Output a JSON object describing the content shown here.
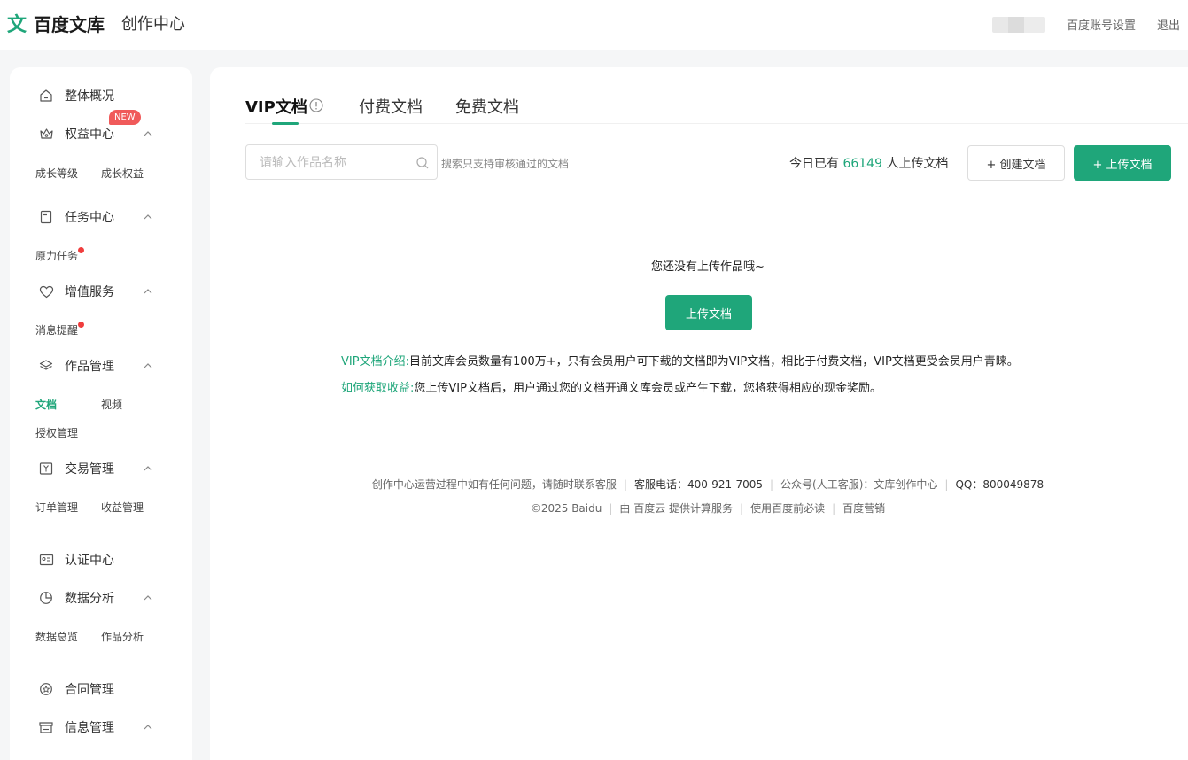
{
  "header": {
    "logo_mark": "文",
    "logo_text": "百度文库",
    "logo_sub": "创作中心",
    "settings_link": "百度账号设置",
    "logout_link": "退出"
  },
  "sidebar": {
    "overview": "整体概况",
    "rights_center": "权益中心",
    "new_badge": "NEW",
    "growth_level": "成长等级",
    "growth_rights": "成长权益",
    "task_center": "任务中心",
    "yuanli_task": "原力任务",
    "value_service": "增值服务",
    "message_remind": "消息提醒",
    "works_manage": "作品管理",
    "docs": "文档",
    "video": "视频",
    "auth_manage": "授权管理",
    "trade_manage": "交易管理",
    "order_manage": "订单管理",
    "income_manage": "收益管理",
    "cert_center": "认证中心",
    "data_analysis": "数据分析",
    "data_overview": "数据总览",
    "works_analysis": "作品分析",
    "contract_manage": "合同管理",
    "info_manage": "信息管理"
  },
  "tabs": {
    "vip": "VIP文档",
    "paid": "付费文档",
    "free": "免费文档"
  },
  "toolbar": {
    "search_placeholder": "请输入作品名称",
    "search_hint": "搜索只支持审核通过的文档",
    "upload_count_prefix": "今日已有",
    "upload_count_num": "66149",
    "upload_count_suffix": "人上传文档",
    "create_btn": "+ 创建文档",
    "upload_btn": "+ 上传文档"
  },
  "empty": {
    "text": "您还没有上传作品哦~",
    "upload_btn": "上传文档",
    "intro_key": "VIP文档介绍:",
    "intro_text": "目前文库会员数量有100万+，只有会员用户可下载的文档即为VIP文档，相比于付费文档，VIP文档更受会员用户青睐。",
    "income_key": "如何获取收益:",
    "income_text": "您上传VIP文档后，用户通过您的文档开通文库会员或产生下载，您将获得相应的现金奖励。"
  },
  "footer": {
    "contact": "创作中心运营过程中如有任何问题，请随时联系客服",
    "phone": "客服电话：400-921-7005",
    "wechat": "公众号(人工客服)：文库创作中心",
    "qq": "QQ：800049878",
    "copyright": "©2025 Baidu",
    "cloud": "由 百度云 提供计算服务",
    "must_read": "使用百度前必读",
    "marketing": "百度营销"
  },
  "colors": {
    "accent": "#1fa67a",
    "badge_red": "#f05a5a"
  }
}
